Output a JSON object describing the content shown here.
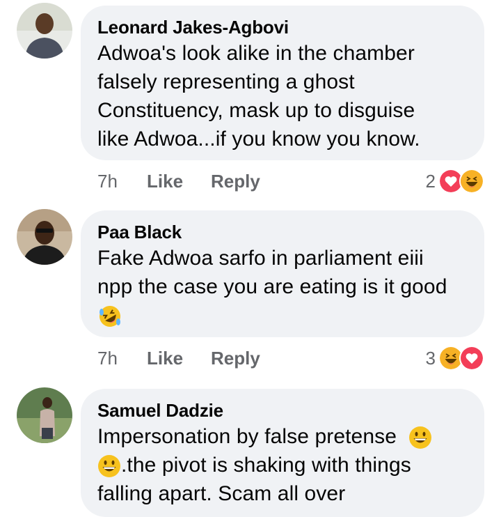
{
  "comments": [
    {
      "author": "Leonard Jakes-Agbovi",
      "lines": [
        "Adwoa's look alike in the chamber",
        "falsely representing a ghost",
        "Constituency, mask up to disguise",
        "like Adwoa...if you know you know."
      ],
      "time": "7h",
      "like_label": "Like",
      "reply_label": "Reply",
      "reaction_count": "2",
      "reactions": [
        "love-icon",
        "haha-icon"
      ]
    },
    {
      "author": "Paa Black",
      "lines": [
        "Fake Adwoa sarfo in parliament eiii",
        "npp the case you are eating is it good"
      ],
      "emoji": "rolling-laughing-emoji",
      "time": "7h",
      "like_label": "Like",
      "reply_label": "Reply",
      "reaction_count": "3",
      "reactions": [
        "haha-icon",
        "love-icon"
      ]
    },
    {
      "author": "Samuel Dadzie",
      "line1": "Impersonation by false pretense",
      "line2_rest": ".the pivot is shaking with things",
      "line3": "falling apart. Scam all over",
      "emojis": [
        "grinning-emoji",
        "grinning-emoji"
      ]
    }
  ],
  "colors": {
    "bubble": "#f0f2f5",
    "meta": "#65676b",
    "love": "#f33e58",
    "haha": "#f7b125"
  }
}
